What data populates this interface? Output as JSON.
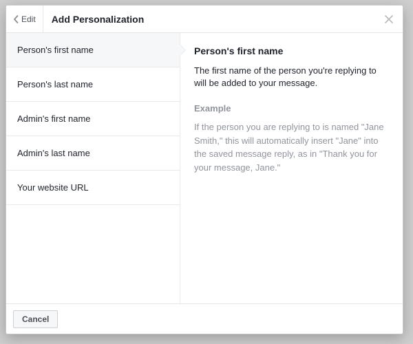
{
  "header": {
    "back_label": "Edit",
    "title": "Add Personalization"
  },
  "sidebar": {
    "items": [
      {
        "label": "Person's first name"
      },
      {
        "label": "Person's last name"
      },
      {
        "label": "Admin's first name"
      },
      {
        "label": "Admin's last name"
      },
      {
        "label": "Your website URL"
      }
    ],
    "selected_index": 0
  },
  "detail": {
    "heading": "Person's first name",
    "description": "The first name of the person you're replying to will be added to your message.",
    "example_label": "Example",
    "example_text": "If the person you are replying to is named \"Jane Smith,\" this will automatically insert \"Jane\" into the saved message reply, as in \"Thank you for your message, Jane.\""
  },
  "footer": {
    "cancel_label": "Cancel"
  }
}
